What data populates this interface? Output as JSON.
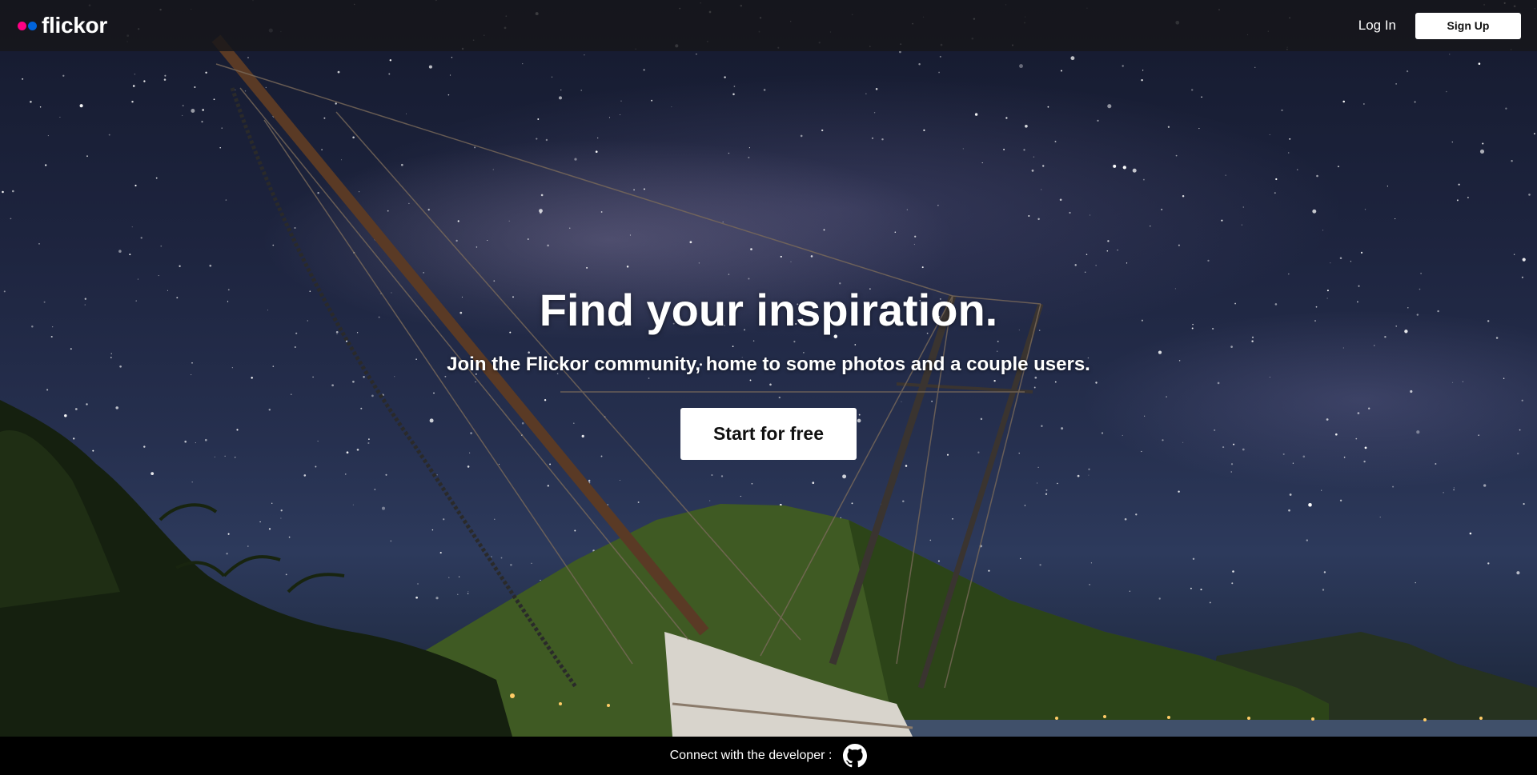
{
  "header": {
    "brand_name": "flickor",
    "login_label": "Log In",
    "signup_label": "Sign Up"
  },
  "hero": {
    "title": "Find your inspiration.",
    "subtitle": "Join the Flickor community, home to some photos and a couple users.",
    "cta_label": "Start for free"
  },
  "footer": {
    "connect_text": "Connect with the developer :",
    "github_icon": "github-icon"
  },
  "colors": {
    "brand_pink": "#ff0084",
    "brand_blue": "#0063dc",
    "topbar": "#16161a",
    "footer": "#000000",
    "button_bg": "#ffffff"
  }
}
